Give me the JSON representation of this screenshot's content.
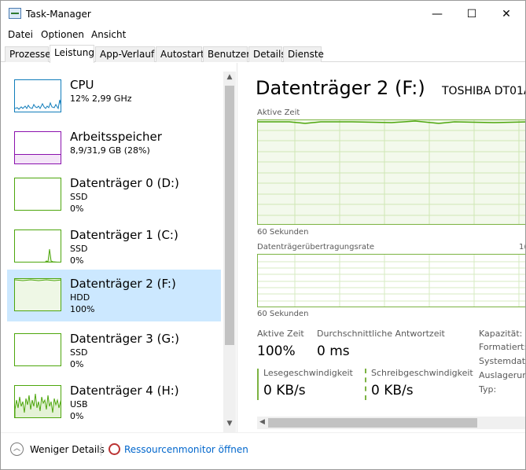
{
  "window": {
    "title": "Task-Manager",
    "minimize": "—",
    "maximize": "☐",
    "close": "✕"
  },
  "menu": [
    "Datei",
    "Optionen",
    "Ansicht"
  ],
  "tabs": [
    "Prozesse",
    "Leistung",
    "App-Verlauf",
    "Autostart",
    "Benutzer",
    "Details",
    "Dienste"
  ],
  "active_tab": "Leistung",
  "devices": [
    {
      "name": "CPU",
      "line1": "12% 2,99 GHz",
      "line2": "",
      "color": "#117dbb"
    },
    {
      "name": "Arbeitsspeicher",
      "line1": "8,9/31,9 GB (28%)",
      "line2": "",
      "color": "#8b12ae"
    },
    {
      "name": "Datenträger 0 (D:)",
      "line1": "SSD",
      "line2": "0%",
      "color": "#4da60c"
    },
    {
      "name": "Datenträger 1 (C:)",
      "line1": "SSD",
      "line2": "0%",
      "color": "#4da60c"
    },
    {
      "name": "Datenträger 2 (F:)",
      "line1": "HDD",
      "line2": "100%",
      "color": "#4da60c"
    },
    {
      "name": "Datenträger 3 (G:)",
      "line1": "SSD",
      "line2": "0%",
      "color": "#4da60c"
    },
    {
      "name": "Datenträger 4 (H:)",
      "line1": "USB",
      "line2": "0%",
      "color": "#4da60c"
    }
  ],
  "detail": {
    "title": "Datenträger 2 (F:)",
    "model": "TOSHIBA DT01A",
    "graph1_label": "Aktive Zeit",
    "graph1_time": "60 Sekunden",
    "graph2_label": "Datenträgerübertragungsrate",
    "graph2_max": "1(",
    "graph2_time": "60 Sekunden",
    "active_time_label": "Aktive Zeit",
    "active_time_value": "100%",
    "response_label": "Durchschnittliche Antwortzeit",
    "response_value": "0 ms",
    "read_label": "Lesegeschwindigkeit",
    "read_value": "0 KB/s",
    "write_label": "Schreibgeschwindigkeit",
    "write_value": "0 KB/s",
    "props": [
      "Kapazität:",
      "Formatiert:",
      "Systemdate",
      "Auslagerun",
      "Typ:"
    ]
  },
  "footer": {
    "less_details": "Weniger Details",
    "resource_monitor": "Ressourcenmonitor öffnen"
  }
}
